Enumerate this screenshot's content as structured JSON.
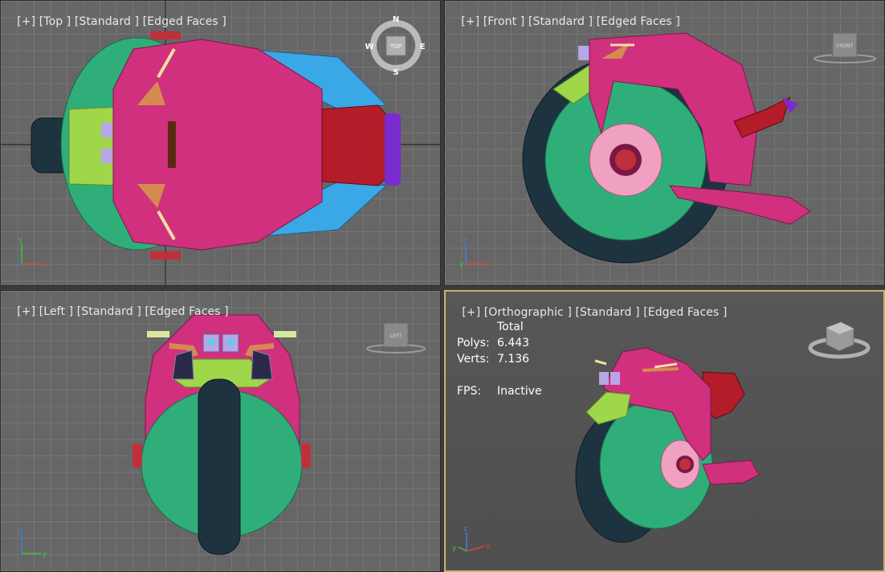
{
  "viewports": [
    {
      "id": "top",
      "labels": {
        "plus": "[+]",
        "view": "[Top ]",
        "shading": "[Standard ]",
        "mode": "[Edged Faces ]"
      }
    },
    {
      "id": "front",
      "labels": {
        "plus": "[+]",
        "view": "[Front ]",
        "shading": "[Standard ]",
        "mode": "[Edged Faces ]"
      }
    },
    {
      "id": "left",
      "labels": {
        "plus": "[+]",
        "view": "[Left ]",
        "shading": "[Standard ]",
        "mode": "[Edged Faces ]"
      }
    },
    {
      "id": "ortho",
      "labels": {
        "plus": "[+]",
        "view": "[Orthographic ]",
        "shading": "[Standard ]",
        "mode": "[Edged Faces ]"
      }
    }
  ],
  "compass": {
    "n": "N",
    "s": "S",
    "e": "E",
    "w": "W",
    "cube": "TOP"
  },
  "viewcubes": {
    "front": "FRONT",
    "left": "LEFT"
  },
  "stats": {
    "header": "Total",
    "polys_label": "Polys:",
    "polys_value": "6.443",
    "verts_label": "Verts:",
    "verts_value": "7.136",
    "fps_label": "FPS:",
    "fps_value": "Inactive"
  },
  "axes": {
    "x": "x",
    "y": "y",
    "z": "z"
  },
  "colors": {
    "body_pink": "#d0307e",
    "sphere_green": "#2fae7a",
    "tire_dark": "#1e3340",
    "accent_red": "#b51c2a",
    "lime": "#9fd64a",
    "cyan": "#3aa7e6",
    "active_border": "#c8b46a"
  }
}
